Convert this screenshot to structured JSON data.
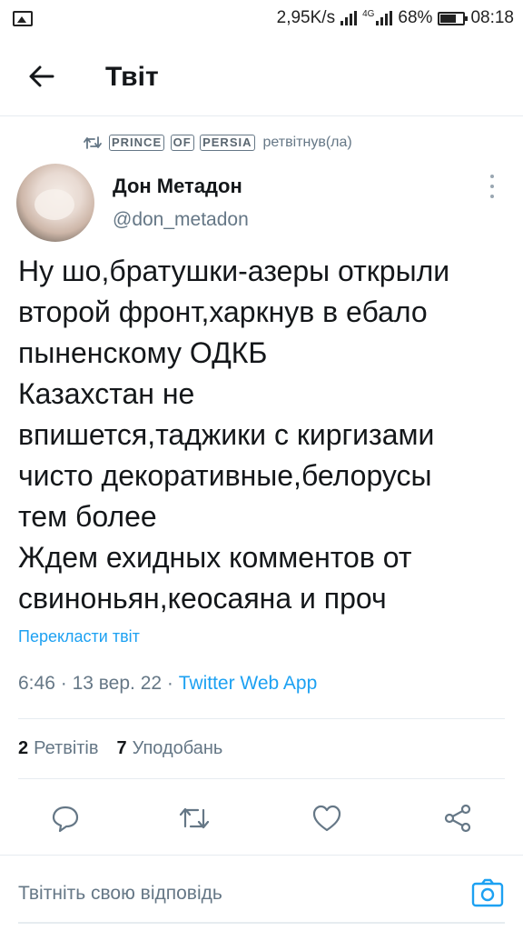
{
  "status_bar": {
    "speed": "2,95K/s",
    "network": "4G",
    "battery": "68%",
    "time": "08:18"
  },
  "header": {
    "title": "Твіт"
  },
  "retweet": {
    "name_words": [
      "PRINCE",
      "OF",
      "PERSIA"
    ],
    "label": "ретвітнув(ла)"
  },
  "author": {
    "name": "Дон Метадон",
    "handle": "@don_metadon"
  },
  "tweet": {
    "lines": [
      "Ну шо,братушки-азеры открыли",
      "второй фронт,харкнув в ебало",
      "пыненскому ОДКБ",
      "Казахстан не",
      "впишется,таджики с киргизами",
      "чисто декоративные,белорусы",
      "тем более",
      "Ждем ехидных комментов от",
      "свиноньян,кеосаяна и проч"
    ],
    "translate": "Перекласти твіт",
    "time": "6:46",
    "separator": "·",
    "date": "13 вер. 22",
    "source": "Twitter Web App"
  },
  "stats": {
    "retweets_count": "2",
    "retweets_label": "Ретвітів",
    "likes_count": "7",
    "likes_label": "Уподобань"
  },
  "icons": {
    "reply": "reply-icon",
    "retweet": "retweet-icon",
    "like": "heart-icon",
    "share": "share-icon",
    "camera": "camera-icon"
  },
  "reply": {
    "placeholder": "Твітніть свою відповідь"
  },
  "colors": {
    "accent": "#1da1f2",
    "secondary_text": "#657786",
    "divider": "#e6ecf0"
  }
}
